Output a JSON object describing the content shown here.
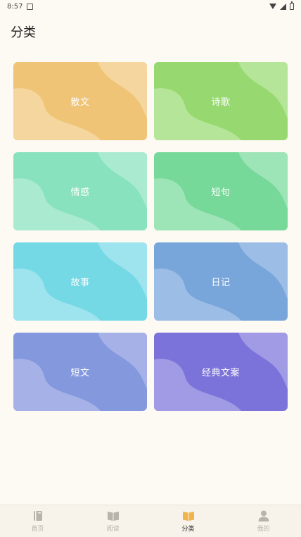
{
  "status_bar": {
    "time": "8:57"
  },
  "page": {
    "title": "分类"
  },
  "categories": [
    {
      "label": "散文",
      "color": "#f0c477",
      "light": "#f4d69e"
    },
    {
      "label": "诗歌",
      "color": "#97d970",
      "light": "#b5e598"
    },
    {
      "label": "情感",
      "color": "#88e2bd",
      "light": "#a9ead1"
    },
    {
      "label": "短句",
      "color": "#76d899",
      "light": "#9de4b6"
    },
    {
      "label": "故事",
      "color": "#74d8e5",
      "light": "#9de4ee"
    },
    {
      "label": "日记",
      "color": "#78a6da",
      "light": "#9bbde6"
    },
    {
      "label": "短文",
      "color": "#8498de",
      "light": "#a6b2e7"
    },
    {
      "label": "经典文案",
      "color": "#7c73da",
      "light": "#a19ae4"
    }
  ],
  "tab_bar": {
    "tabs": [
      {
        "label": "首页",
        "icon": "home-book-icon",
        "active": false
      },
      {
        "label": "阅读",
        "icon": "open-book-icon",
        "active": false
      },
      {
        "label": "分类",
        "icon": "category-book-icon",
        "active": true,
        "accent": "#f0b44a"
      },
      {
        "label": "我的",
        "icon": "user-icon",
        "active": false
      }
    ]
  }
}
